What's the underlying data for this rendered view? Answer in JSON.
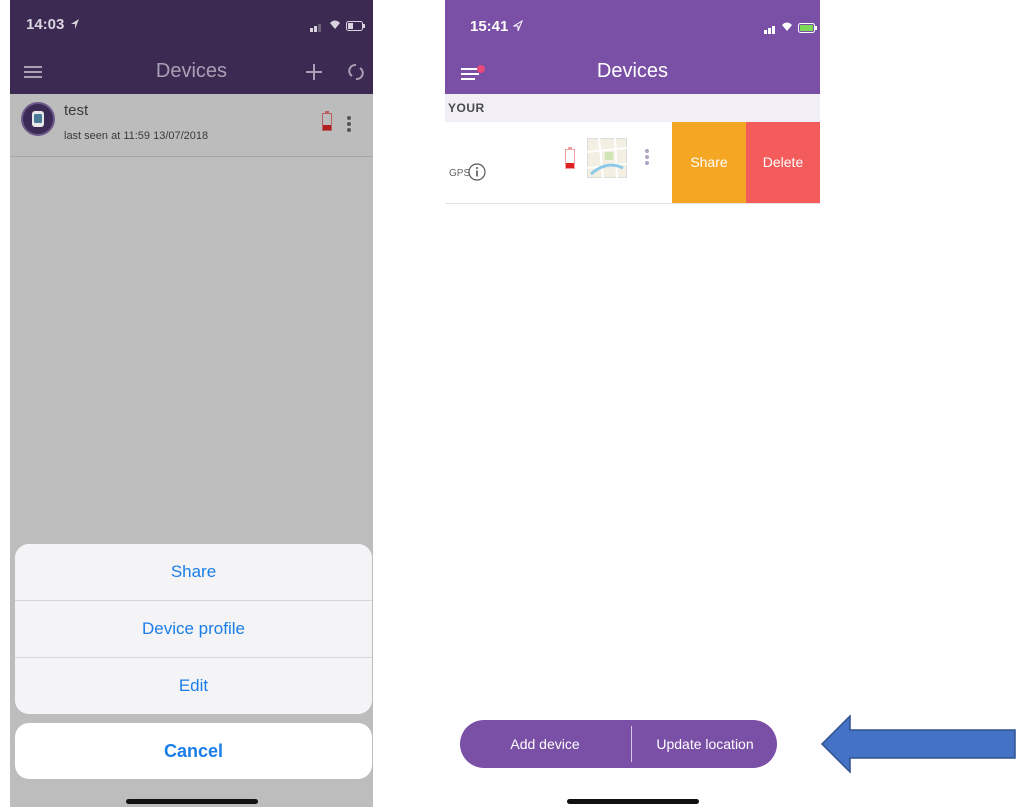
{
  "left_screen": {
    "status_time": "14:03",
    "nav_title": "Devices",
    "device": {
      "name": "test",
      "last_seen": "last seen at 11:59 13/07/2018"
    },
    "action_sheet": {
      "items": [
        {
          "label": "Share"
        },
        {
          "label": "Device profile"
        },
        {
          "label": "Edit"
        }
      ],
      "cancel_label": "Cancel"
    }
  },
  "right_screen": {
    "status_time": "15:41",
    "nav_title": "Devices",
    "section_header": "YOUR",
    "device_row": {
      "gps_label": "GPS",
      "share_label": "Share",
      "delete_label": "Delete"
    },
    "bottom_bar": {
      "add_device_label": "Add device",
      "update_location_label": "Update location"
    }
  },
  "colors": {
    "left_header": "#3c2a52",
    "right_header": "#7a4fa6",
    "share_swipe": "#f5a623",
    "delete_swipe": "#f45b5b",
    "sheet_text": "#1a7de8",
    "arrow_fill": "#4472c4"
  }
}
